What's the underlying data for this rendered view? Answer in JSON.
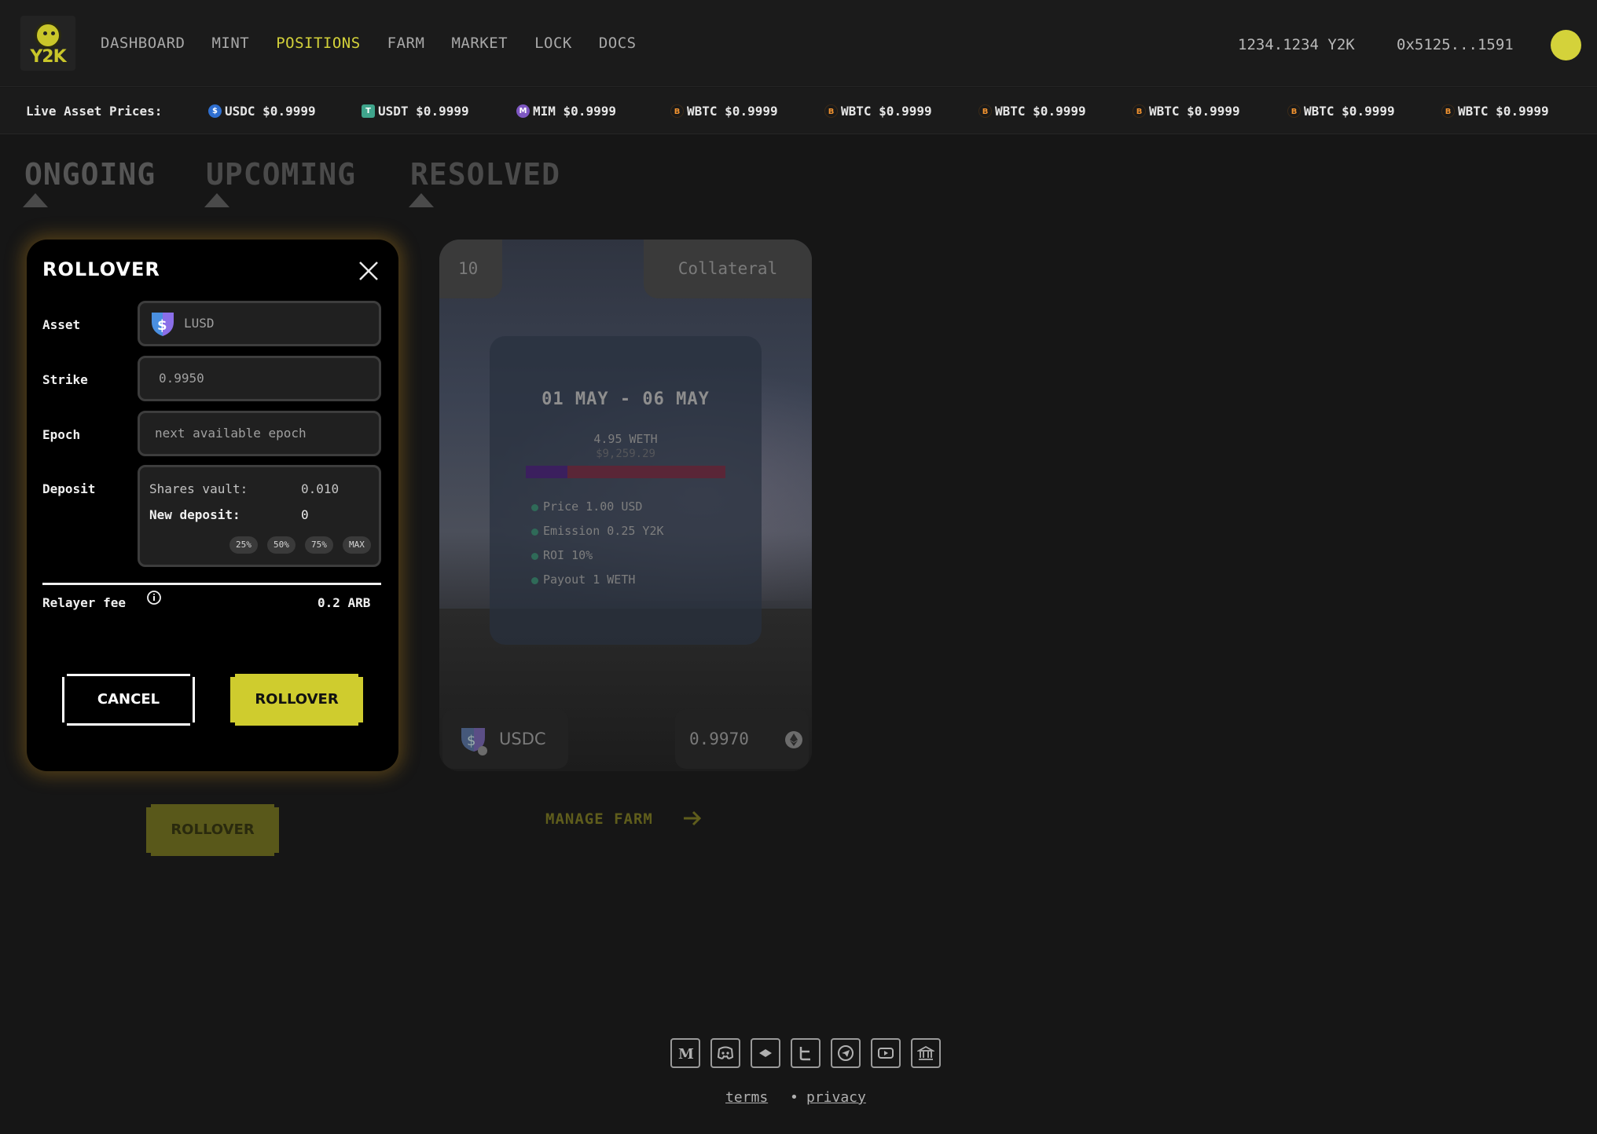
{
  "header": {
    "logo_text": "Y2K",
    "nav": [
      {
        "label": "DASHBOARD",
        "active": false
      },
      {
        "label": "MINT",
        "active": false
      },
      {
        "label": "POSITIONS",
        "active": true
      },
      {
        "label": "FARM",
        "active": false
      },
      {
        "label": "MARKET",
        "active": false
      },
      {
        "label": "LOCK",
        "active": false
      },
      {
        "label": "DOCS",
        "active": false
      }
    ],
    "balance": "1234.1234 Y2K",
    "wallet": "0x5125...1591",
    "accent_color": "#d4d23a"
  },
  "ticker": {
    "label": "Live Asset Prices:",
    "items": [
      {
        "symbol": "USDC",
        "price": "$0.9999",
        "icon": "usdc-icon"
      },
      {
        "symbol": "USDT",
        "price": "$0.9999",
        "icon": "usdt-icon"
      },
      {
        "symbol": "MIM",
        "price": "$0.9999",
        "icon": "mim-icon"
      },
      {
        "symbol": "WBTC",
        "price": "$0.9999",
        "icon": "wbtc-icon"
      },
      {
        "symbol": "WBTC",
        "price": "$0.9999",
        "icon": "wbtc-icon"
      },
      {
        "symbol": "WBTC",
        "price": "$0.9999",
        "icon": "wbtc-icon"
      },
      {
        "symbol": "WBTC",
        "price": "$0.9999",
        "icon": "wbtc-icon"
      },
      {
        "symbol": "WBTC",
        "price": "$0.9999",
        "icon": "wbtc-icon"
      },
      {
        "symbol": "WBTC",
        "price": "$0.9999",
        "icon": "wbtc-icon"
      }
    ]
  },
  "tabs": [
    {
      "label": "ONGOING",
      "active": true
    },
    {
      "label": "UPCOMING",
      "active": false
    },
    {
      "label": "RESOLVED",
      "active": false
    }
  ],
  "rollover_modal": {
    "title": "ROLLOVER",
    "asset_label": "Asset",
    "asset_value": "LUSD",
    "strike_label": "Strike",
    "strike_value": "0.9950",
    "epoch_label": "Epoch",
    "epoch_value": "next available epoch",
    "deposit_label": "Deposit",
    "shares_vault_label": "Shares vault:",
    "shares_vault_value": "0.010",
    "new_deposit_label": "New deposit:",
    "new_deposit_value": "0",
    "pct_buttons": [
      "25%",
      "50%",
      "75%",
      "MAX"
    ],
    "relayer_fee_label": "Relayer fee",
    "relayer_fee_value": "0.2 ARB",
    "cancel_label": "CANCEL",
    "rollover_label": "ROLLOVER"
  },
  "background_rollover_button": "ROLLOVER",
  "position_card": {
    "id": "10",
    "type": "Collateral",
    "date_range": "01 MAY - 06 MAY",
    "amount": "4.95 WETH",
    "amount_usd": "$9,259.29",
    "progress": 0.21,
    "details": [
      "Price  1.00 USD",
      "Emission 0.25 Y2K",
      "ROI 10%",
      "Payout 1 WETH"
    ],
    "asset": "USDC",
    "strike": "0.9970"
  },
  "manage_farm_label": "MANAGE FARM",
  "footer": {
    "social_icons": [
      "medium-icon",
      "discord-icon",
      "gitbook-icon",
      "twitter-icon",
      "telegram-icon",
      "youtube-icon",
      "governance-icon"
    ],
    "terms_label": "terms",
    "separator": "•",
    "privacy_label": "privacy"
  }
}
